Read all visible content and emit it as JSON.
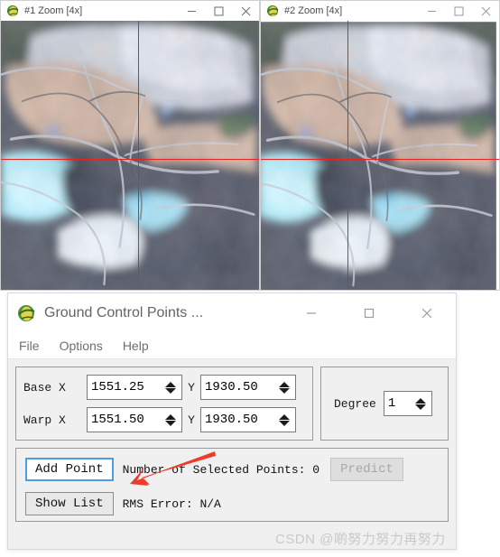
{
  "zoom_windows": [
    {
      "title": "#1 Zoom [4x]",
      "icon": "envi-globe-icon",
      "minimize_label": "—",
      "maximize_label": "□",
      "close_label": "✕",
      "crosshair": {
        "x_pct": 53.0,
        "y_pct": 51.5,
        "color": "#e8221f"
      }
    },
    {
      "title": "#2 Zoom [4x]",
      "icon": "envi-globe-icon",
      "minimize_label": "—",
      "maximize_label": "□",
      "close_label": "✕",
      "crosshair": {
        "x_pct": 36.5,
        "y_pct": 51.5,
        "color": "#e8221f"
      }
    }
  ],
  "dialog": {
    "title": "Ground Control Points ...",
    "icon": "envi-globe-icon",
    "window_controls": {
      "minimize_label": "—",
      "maximize_label": "□",
      "close_label": "✕"
    },
    "menu": [
      {
        "label": "File"
      },
      {
        "label": "Options"
      },
      {
        "label": "Help"
      }
    ],
    "coordinates": {
      "base": {
        "row_label": "Base X",
        "x_value": "1551.25",
        "y_label": "Y",
        "y_value": "1930.50"
      },
      "warp": {
        "row_label": "Warp X",
        "x_value": "1551.50",
        "y_label": "Y",
        "y_value": "1930.50"
      }
    },
    "degree": {
      "label": "Degree",
      "value": "1"
    },
    "actions": {
      "add_point_label": "Add Point",
      "selected_points_text": "Number of Selected Points: 0",
      "predict_label": "Predict",
      "predict_enabled": false,
      "show_list_label": "Show List",
      "rms_error_text": "RMS Error: N/A"
    }
  },
  "annotation": {
    "arrow_color": "#ee3b2b",
    "points_to": "add-point-button"
  },
  "watermark": {
    "text": "CSDN @啲努力努力再努力"
  }
}
